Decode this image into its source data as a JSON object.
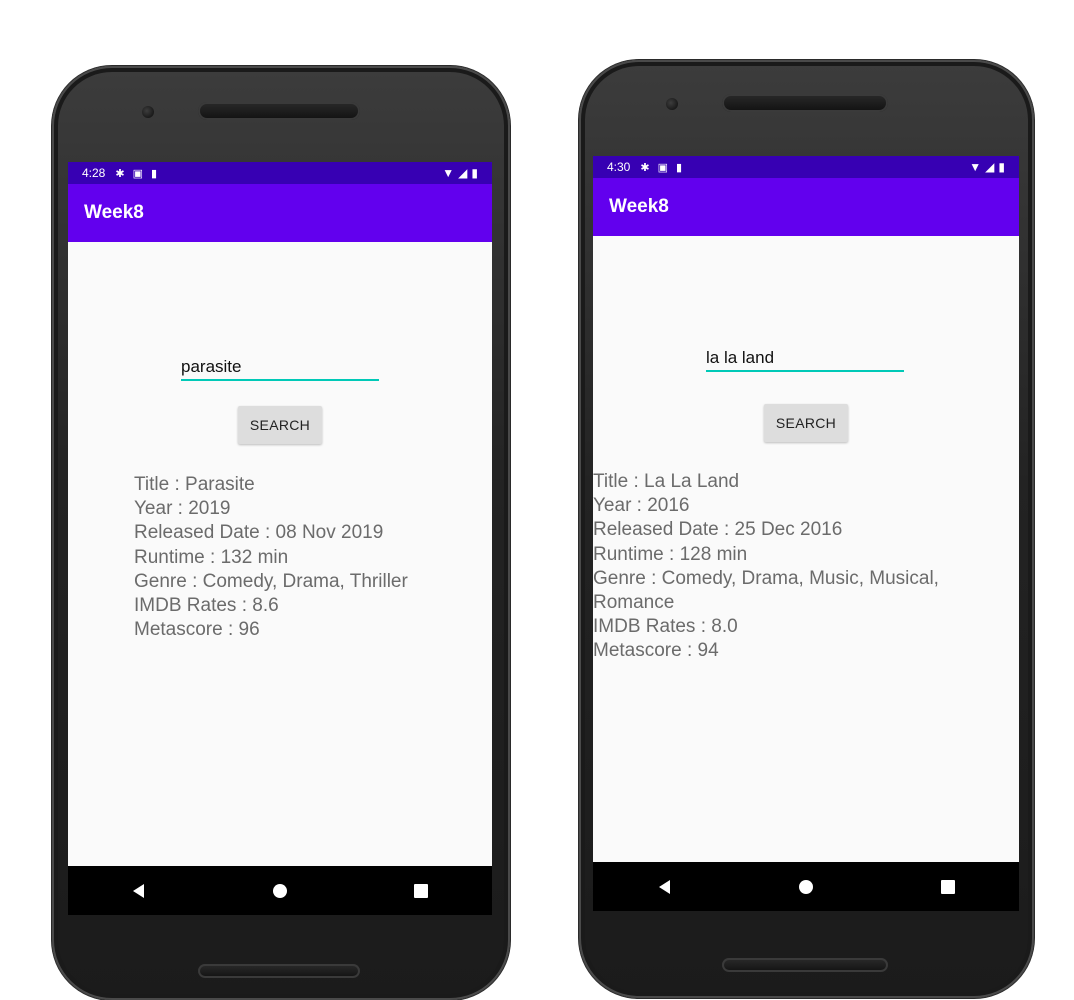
{
  "phones": [
    {
      "status_bar": {
        "time": "4:28"
      },
      "app_bar": {
        "title": "Week8"
      },
      "search": {
        "value": "parasite",
        "button_label": "SEARCH"
      },
      "result": {
        "title": "Title : Parasite",
        "year": "Year : 2019",
        "released": "Released Date : 08 Nov 2019",
        "runtime": "Runtime : 132 min",
        "genre": "Genre : Comedy, Drama, Thriller",
        "imdb": "IMDB Rates : 8.6",
        "metascore": "Metascore : 96"
      }
    },
    {
      "status_bar": {
        "time": "4:30"
      },
      "app_bar": {
        "title": "Week8"
      },
      "search": {
        "value": "la la land",
        "button_label": "SEARCH"
      },
      "result": {
        "title": "Title : La La Land",
        "year": "Year : 2016",
        "released": "Released Date : 25 Dec 2016",
        "runtime": "Runtime : 128 min",
        "genre": "Genre : Comedy, Drama, Music, Musical, Romance",
        "imdb": "IMDB Rates : 8.0",
        "metascore": "Metascore : 94"
      }
    }
  ],
  "colors": {
    "status_bar": "#3700b3",
    "app_bar": "#6200ee",
    "input_underline": "#00c9b7"
  },
  "icons": [
    "settings-icon",
    "notification-a-icon",
    "sd-card-icon",
    "wifi-icon",
    "signal-icon",
    "battery-icon",
    "nav-back-icon",
    "nav-home-icon",
    "nav-recents-icon"
  ]
}
